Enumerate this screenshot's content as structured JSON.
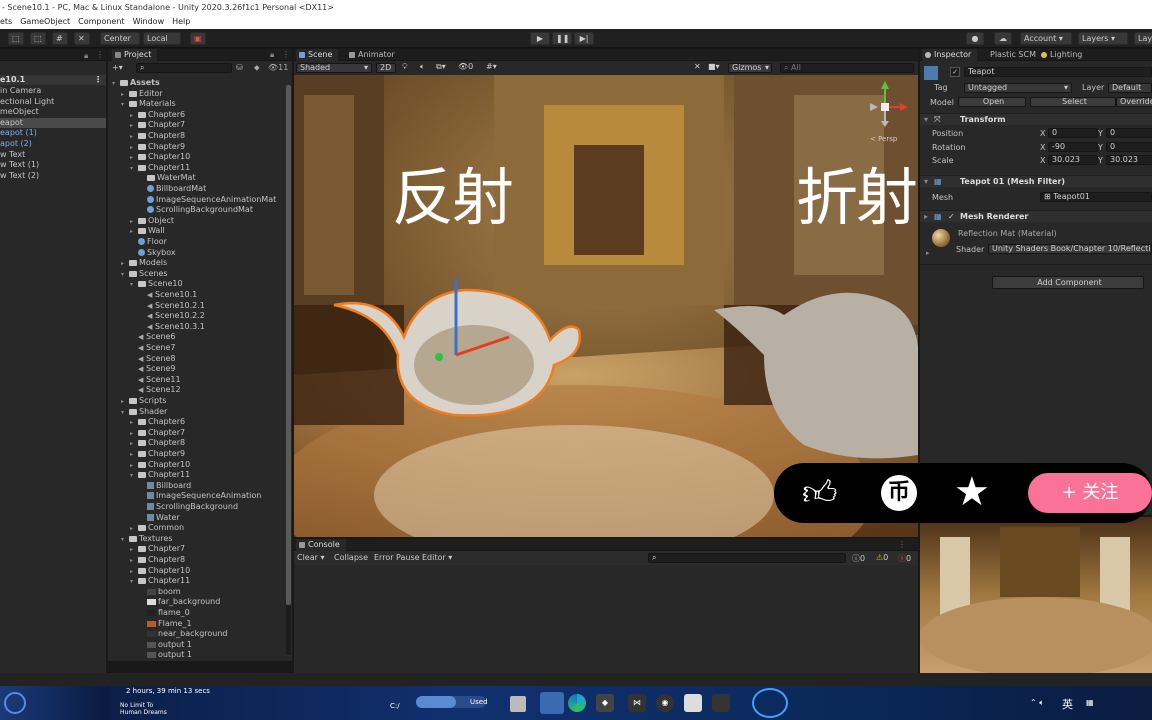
{
  "window": {
    "title": "- Scene10.1 - PC, Mac & Linux Standalone - Unity 2020.3.26f1c1 Personal <DX11>"
  },
  "menu": [
    "ets",
    "GameObject",
    "Component",
    "Window",
    "Help"
  ],
  "toolbar": {
    "center": "Center",
    "local": "Local",
    "account": "Account",
    "layers": "Layers",
    "layout": "Lay"
  },
  "hierarchy": {
    "scene": "e10.1",
    "items": [
      {
        "label": "in Camera",
        "blue": false
      },
      {
        "label": "ectional Light",
        "blue": false
      },
      {
        "label": "meObject",
        "blue": false
      },
      {
        "label": "eapot",
        "blue": false,
        "selected": true
      },
      {
        "label": "eapot (1)",
        "blue": true
      },
      {
        "label": "apot (2)",
        "blue": true
      },
      {
        "label": "w Text",
        "blue": false
      },
      {
        "label": "w Text (1)",
        "blue": false
      },
      {
        "label": "w Text (2)",
        "blue": false
      }
    ]
  },
  "project": {
    "tab": "Project",
    "count": "11",
    "items": [
      {
        "label": "Assets",
        "d": 0,
        "k": "folder-open",
        "bold": true
      },
      {
        "label": "Editor",
        "d": 1,
        "k": "folder"
      },
      {
        "label": "Materials",
        "d": 1,
        "k": "folder-open"
      },
      {
        "label": "Chapter6",
        "d": 2,
        "k": "folder"
      },
      {
        "label": "Chapter7",
        "d": 2,
        "k": "folder"
      },
      {
        "label": "Chapter8",
        "d": 2,
        "k": "folder"
      },
      {
        "label": "Chapter9",
        "d": 2,
        "k": "folder"
      },
      {
        "label": "Chapter10",
        "d": 2,
        "k": "folder"
      },
      {
        "label": "Chapter11",
        "d": 2,
        "k": "folder-open"
      },
      {
        "label": "WaterMat",
        "d": 3,
        "k": "folder-leaf"
      },
      {
        "label": "BillboardMat",
        "d": 3,
        "k": "mat"
      },
      {
        "label": "ImageSequenceAnimationMat",
        "d": 3,
        "k": "mat"
      },
      {
        "label": "ScrollingBackgroundMat",
        "d": 3,
        "k": "mat"
      },
      {
        "label": "Object",
        "d": 2,
        "k": "folder"
      },
      {
        "label": "Wall",
        "d": 2,
        "k": "folder"
      },
      {
        "label": "Floor",
        "d": 2,
        "k": "mat"
      },
      {
        "label": "Skybox",
        "d": 2,
        "k": "mat"
      },
      {
        "label": "Models",
        "d": 1,
        "k": "folder"
      },
      {
        "label": "Scenes",
        "d": 1,
        "k": "folder-open"
      },
      {
        "label": "Scene10",
        "d": 2,
        "k": "folder-open"
      },
      {
        "label": "Scene10.1",
        "d": 3,
        "k": "scene"
      },
      {
        "label": "Scene10.2.1",
        "d": 3,
        "k": "scene"
      },
      {
        "label": "Scene10.2.2",
        "d": 3,
        "k": "scene"
      },
      {
        "label": "Scene10.3.1",
        "d": 3,
        "k": "scene"
      },
      {
        "label": "Scene6",
        "d": 2,
        "k": "scene"
      },
      {
        "label": "Scene7",
        "d": 2,
        "k": "scene"
      },
      {
        "label": "Scene8",
        "d": 2,
        "k": "scene"
      },
      {
        "label": "Scene9",
        "d": 2,
        "k": "scene"
      },
      {
        "label": "Scene11",
        "d": 2,
        "k": "scene"
      },
      {
        "label": "Scene12",
        "d": 2,
        "k": "scene"
      },
      {
        "label": "Scripts",
        "d": 1,
        "k": "folder"
      },
      {
        "label": "Shader",
        "d": 1,
        "k": "folder-open"
      },
      {
        "label": "Chapter6",
        "d": 2,
        "k": "folder"
      },
      {
        "label": "Chapter7",
        "d": 2,
        "k": "folder"
      },
      {
        "label": "Chapter8",
        "d": 2,
        "k": "folder"
      },
      {
        "label": "Chapter9",
        "d": 2,
        "k": "folder"
      },
      {
        "label": "Chapter10",
        "d": 2,
        "k": "folder"
      },
      {
        "label": "Chapter11",
        "d": 2,
        "k": "folder-open"
      },
      {
        "label": "Billboard",
        "d": 3,
        "k": "shader"
      },
      {
        "label": "ImageSequenceAnimation",
        "d": 3,
        "k": "shader"
      },
      {
        "label": "ScrollingBackground",
        "d": 3,
        "k": "shader"
      },
      {
        "label": "Water",
        "d": 3,
        "k": "shader"
      },
      {
        "label": "Common",
        "d": 2,
        "k": "folder"
      },
      {
        "label": "Textures",
        "d": 1,
        "k": "folder-open"
      },
      {
        "label": "Chapter7",
        "d": 2,
        "k": "folder"
      },
      {
        "label": "Chapter8",
        "d": 2,
        "k": "folder"
      },
      {
        "label": "Chapter10",
        "d": 2,
        "k": "folder"
      },
      {
        "label": "Chapter11",
        "d": 2,
        "k": "folder-open"
      },
      {
        "label": "boom",
        "d": 3,
        "k": "tex",
        "c": "#444"
      },
      {
        "label": "far_background",
        "d": 3,
        "k": "tex",
        "c": "#ddd"
      },
      {
        "label": "flame_0",
        "d": 3,
        "k": "tex",
        "c": "#222"
      },
      {
        "label": "Flame_1",
        "d": 3,
        "k": "tex",
        "c": "#c0562a"
      },
      {
        "label": "near_background",
        "d": 3,
        "k": "tex",
        "c": "#333"
      },
      {
        "label": "output 1",
        "d": 3,
        "k": "tex",
        "c": "#555"
      },
      {
        "label": "output 1",
        "d": 3,
        "k": "tex",
        "c": "#555"
      }
    ]
  },
  "scene": {
    "tab": "Scene",
    "tab2": "Animator",
    "shading": "Shaded",
    "mode2d": "2D",
    "layers": "0",
    "gizmos": "Gizmos",
    "search": "All",
    "persp": "< Persp",
    "text_left": "反射",
    "text_right": "折射"
  },
  "console": {
    "tab": "Console",
    "clear": "Clear",
    "collapse": "Collapse",
    "error_pause": "Error Pause",
    "editor": "Editor",
    "c1": "0",
    "c2": "0",
    "c3": "0"
  },
  "inspector": {
    "tab": "Inspector",
    "tab2": "Plastic SCM",
    "tab3": "Lighting",
    "name": "Teapot",
    "tag_label": "Tag",
    "tag": "Untagged",
    "layer_label": "Layer",
    "layer": "Default",
    "model_label": "Model",
    "open": "Open",
    "select": "Select",
    "overrides": "Overrides",
    "transform": "Transform",
    "rows": [
      {
        "label": "Position",
        "x": "0",
        "y": "0"
      },
      {
        "label": "Rotation",
        "x": "-90",
        "y": "0"
      },
      {
        "label": "Scale",
        "x": "30.023",
        "y": "30.023"
      }
    ],
    "mesh_filter": "Teapot 01 (Mesh Filter)",
    "mesh_label": "Mesh",
    "mesh": "Teapot01",
    "mesh_renderer": "Mesh Renderer",
    "material": "Reflection Mat (Material)",
    "shader_label": "Shader",
    "shader": "Unity Shaders Book/Chapter 10/Reflection",
    "add_component": "Add Component"
  },
  "overlay": {
    "follow": "+ 关注"
  },
  "taskbar": {
    "timer": "2 hours, 39 min 13 secs",
    "drive": "C:/",
    "used": "Used",
    "lang": "英",
    "promo": "No Limit To",
    "promo2": "Human Dreams"
  },
  "colors": {
    "accent": "#3a72b0",
    "follow": "#fb7299",
    "selection": "#f07d20"
  }
}
